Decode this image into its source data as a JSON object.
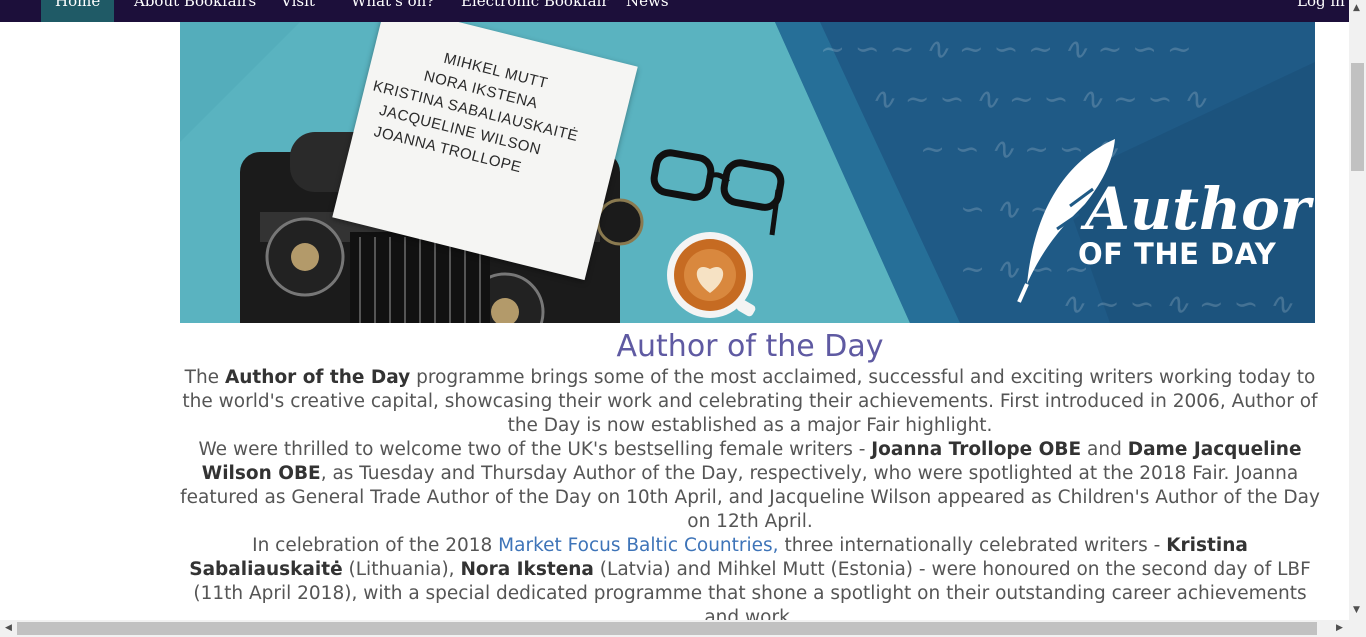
{
  "nav": {
    "items": [
      {
        "label": "Home",
        "active": true
      },
      {
        "label": "About Bookfairs"
      },
      {
        "label": "Visit"
      },
      {
        "label": "What's on?"
      },
      {
        "label": "Electronic Bookfair"
      },
      {
        "label": "News"
      }
    ],
    "login": "Log in"
  },
  "banner": {
    "paper_names": [
      "MIHKEL MUTT",
      "NORA IKSTENA",
      "KRISTINA SABALIAUSKAITĖ",
      "JACQUELINE WILSON",
      "JOANNA TROLLOPE"
    ],
    "logo_title": "Author",
    "logo_subtitle": "OF THE DAY"
  },
  "main": {
    "heading": "Author of the Day",
    "p1": {
      "t1": "The ",
      "b1": "Author of the Day",
      "t2": " programme brings some of the most acclaimed, successful and exciting writers working today to the world's creative capital, showcasing their work and celebrating their achievements. First introduced in 2006, Author of the Day is now established as a major Fair highlight."
    },
    "p2": {
      "t1": "We were thrilled to welcome two of the UK's bestselling female writers - ",
      "b1": "Joanna Trollope OBE",
      "t2": " and ",
      "b2": "Dame Jacqueline Wilson OBE",
      "t3": ", as Tuesday and Thursday Author of the Day, respectively, who were spotlighted at the 2018 Fair. Joanna featured as General Trade Author of the Day on 10th April, and Jacqueline Wilson appeared as Children's Author of the Day on 12th April."
    },
    "p3": {
      "t1": "In celebration of the 2018 ",
      "link": "Market Focus Baltic Countries,",
      "t2": " three internationally celebrated writers - ",
      "b1": "Kristina Sabaliauskaitė",
      "t3": " (Lithuania), ",
      "b2": "Nora Ikstena",
      "t4": " (Latvia) and Mihkel Mutt (Estonia) - were honoured on the second day of LBF (11th April 2018), with a special dedicated programme that shone a spotlight on their outstanding career achievements and work."
    }
  },
  "colors": {
    "nav_bg": "#1c0f3a",
    "nav_active": "#1f5a66",
    "heading": "#5f5aa2",
    "link": "#3e74b8",
    "banner_teal": "#5ab3c0",
    "banner_navy": "#1f5a86"
  }
}
